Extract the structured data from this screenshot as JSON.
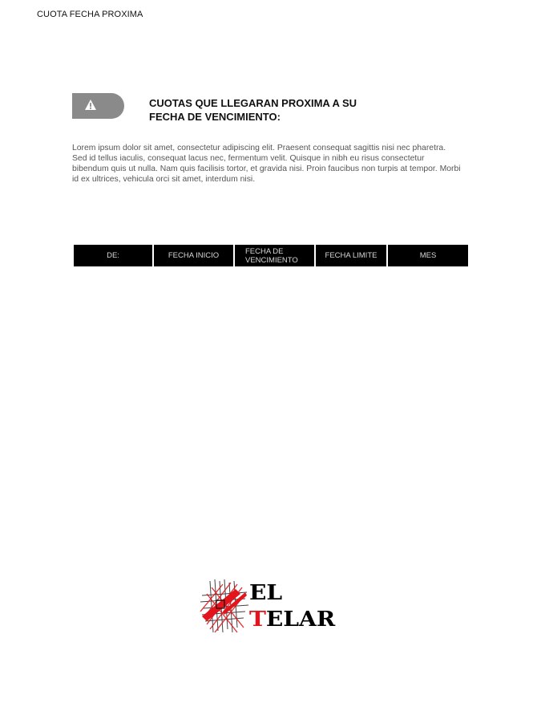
{
  "frame": {
    "title": "CUOTA FECHA PROXIMA"
  },
  "alert": {
    "icon": "warning-icon",
    "badge_color": "#8a8a8a",
    "heading_line1": "CUOTAS QUE LLEGARAN PROXIMA A SU",
    "heading_line2": "FECHA DE VENCIMIENTO:",
    "body": "Lorem ipsum dolor sit amet, consectetur adipiscing elit. Praesent consequat sagittis nisi nec pharetra. Sed id tellus iaculis, consequat lacus nec, fermentum velit. Quisque in nibh eu risus consectetur bibendum quis ut nulla. Nam quis facilisis tortor, et gravida nisi. Proin faucibus non turpis at tempor. Morbi id ex ultrices, vehicula orci sit amet, interdum nisi."
  },
  "table": {
    "columns": [
      "DE:",
      "FECHA INICIO",
      "FECHA DE VENCIMIENTO",
      "FECHA LIMITE",
      "MES"
    ],
    "header_bg": "#000000"
  },
  "logo": {
    "word1": "EL",
    "word2_first": "T",
    "word2_rest": "ELAR",
    "accent_color": "#e3141b"
  }
}
